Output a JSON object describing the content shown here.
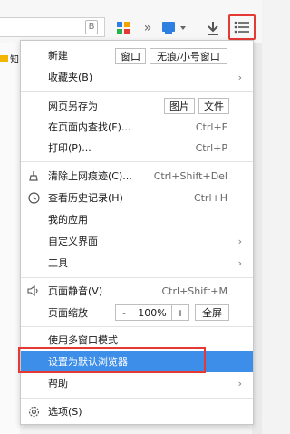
{
  "toolbar": {
    "address_b": "B"
  },
  "bookmarks": {
    "partial_label": "知"
  },
  "menu": {
    "new": {
      "label": "新建",
      "window": "窗口",
      "incognito": "无痕/小号窗口"
    },
    "favorites": {
      "label": "收藏夹(B)"
    },
    "save_page": {
      "label": "网页另存为",
      "image": "图片",
      "file": "文件"
    },
    "find": {
      "label": "在页面内查找(F)...",
      "shortcut": "Ctrl+F"
    },
    "print": {
      "label": "打印(P)...",
      "shortcut": "Ctrl+P"
    },
    "clear": {
      "label": "清除上网痕迹(C)...",
      "shortcut": "Ctrl+Shift+Del"
    },
    "history": {
      "label": "查看历史记录(H)",
      "shortcut": "Ctrl+H"
    },
    "my_apps": {
      "label": "我的应用"
    },
    "customize": {
      "label": "自定义界面"
    },
    "tools": {
      "label": "工具"
    },
    "mute": {
      "label": "页面静音(V)",
      "shortcut": "Ctrl+Shift+M"
    },
    "zoom": {
      "label": "页面缩放",
      "minus": "-",
      "value": "100%",
      "plus": "+",
      "fullscreen": "全屏"
    },
    "multi_window": {
      "label": "使用多窗口模式"
    },
    "set_default": {
      "label": "设置为默认浏览器"
    },
    "help": {
      "label": "帮助"
    },
    "options": {
      "label": "选项(S)"
    }
  },
  "colors": {
    "highlight": "#3d8ee8",
    "annotation": "#e53935"
  }
}
